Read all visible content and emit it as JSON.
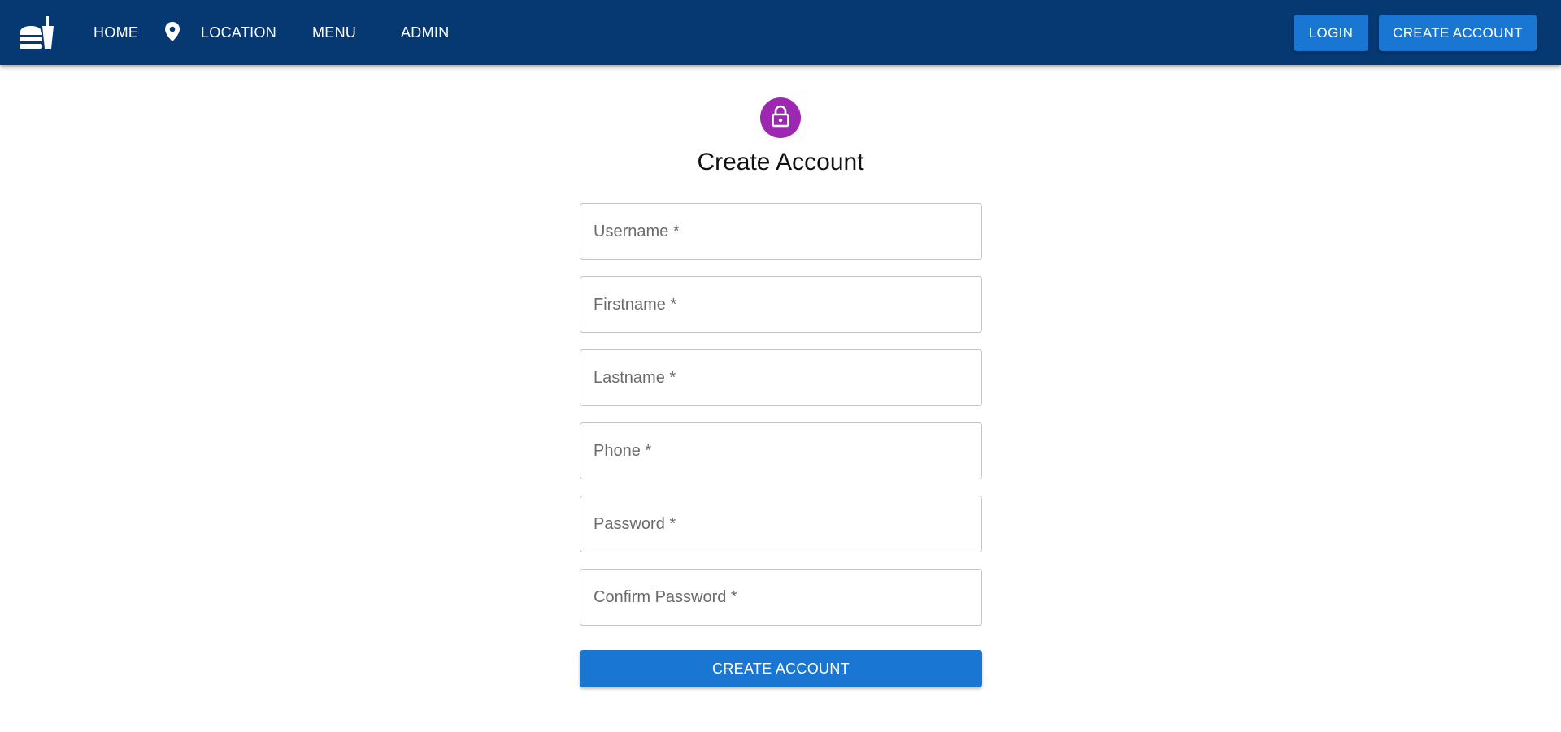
{
  "header": {
    "logo_icon": "fastfood-icon",
    "nav": {
      "home": "HOME",
      "location_icon": "location-pin-icon",
      "location": "LOCATION",
      "menu": "MENU",
      "admin": "ADMIN"
    },
    "login_label": "LOGIN",
    "create_account_label": "CREATE ACCOUNT"
  },
  "form": {
    "icon": "lock-icon",
    "title": "Create Account",
    "fields": [
      {
        "placeholder": "Username *",
        "value": ""
      },
      {
        "placeholder": "Firstname *",
        "value": ""
      },
      {
        "placeholder": "Lastname *",
        "value": ""
      },
      {
        "placeholder": "Phone *",
        "value": ""
      },
      {
        "placeholder": "Password *",
        "value": ""
      },
      {
        "placeholder": "Confirm Password *",
        "value": ""
      }
    ],
    "submit_label": "CREATE ACCOUNT"
  },
  "colors": {
    "appbar": "#063872",
    "primary": "#1976d2",
    "avatar": "#9c27b0"
  }
}
